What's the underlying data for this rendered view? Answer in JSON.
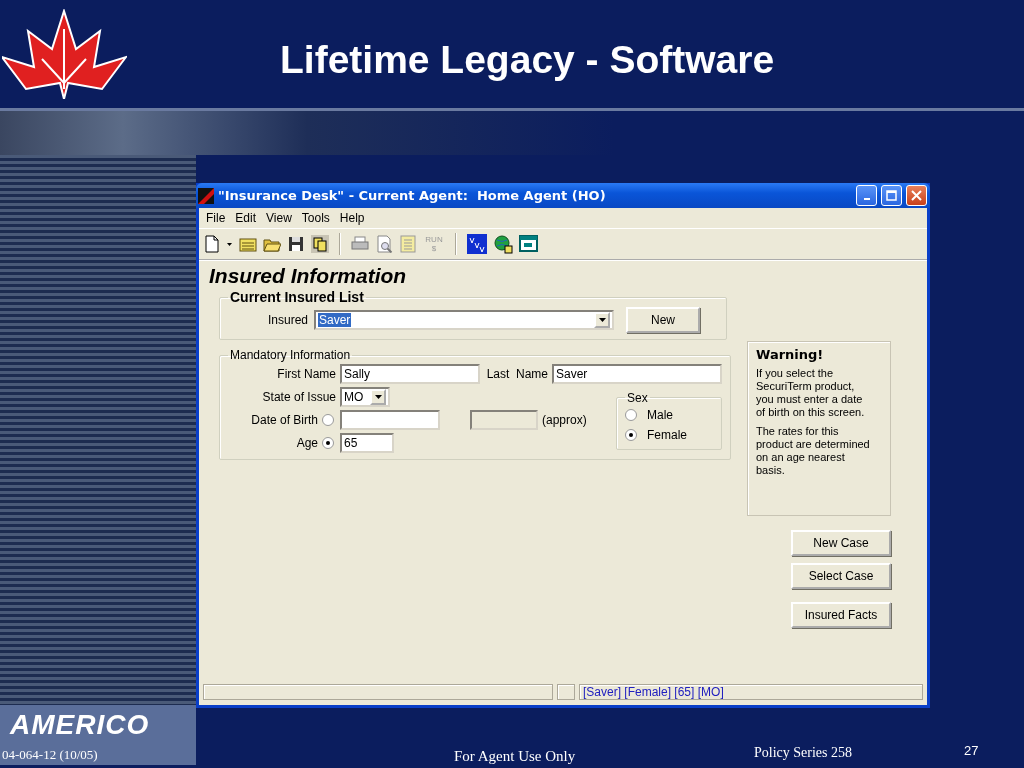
{
  "slide": {
    "title": "Lifetime Legacy - Software",
    "logo_text": "AMERICO",
    "footer_code": "04-064-12 (10/05)",
    "footer_center": "For Agent Use Only",
    "footer_series": "Policy Series 258",
    "page_number": "27"
  },
  "window": {
    "title": "\"Insurance Desk\" - Current Agent:  Home Agent (HO)"
  },
  "menu": [
    "File",
    "Edit",
    "View",
    "Tools",
    "Help"
  ],
  "toolbar": {
    "run_label": "RUN",
    "run_symbol": "$",
    "run_disabled": true
  },
  "form": {
    "heading": "Insured Information",
    "insured_list": {
      "legend": "Current Insured List",
      "label": "Insured",
      "value": "Saver",
      "new_button": "New"
    },
    "mandatory": {
      "legend": "Mandatory Information",
      "first_name_label": "First Name",
      "first_name": "Sally",
      "last_name_label": "Last  Name",
      "last_name": "Saver",
      "state_label": "State of Issue",
      "state": "MO",
      "dob_label": "Date of Birth",
      "dob_selected": false,
      "approx_label": "(approx)",
      "age_label": "Age",
      "age_selected": true,
      "age": "65",
      "sex": {
        "legend": "Sex",
        "options": [
          {
            "label": "Male",
            "selected": false
          },
          {
            "label": "Female",
            "selected": true
          }
        ]
      }
    }
  },
  "warning": {
    "title": "Warning!",
    "paragraphs": [
      "If you select the SecuriTerm product, you must enter a date of birth on this screen.",
      "The rates for this product are determined on an age nearest basis."
    ]
  },
  "buttons": [
    "New Case",
    "Select Case",
    "Insured Facts"
  ],
  "status_bar": {
    "text": "[Saver] [Female] [65] [MO]"
  }
}
